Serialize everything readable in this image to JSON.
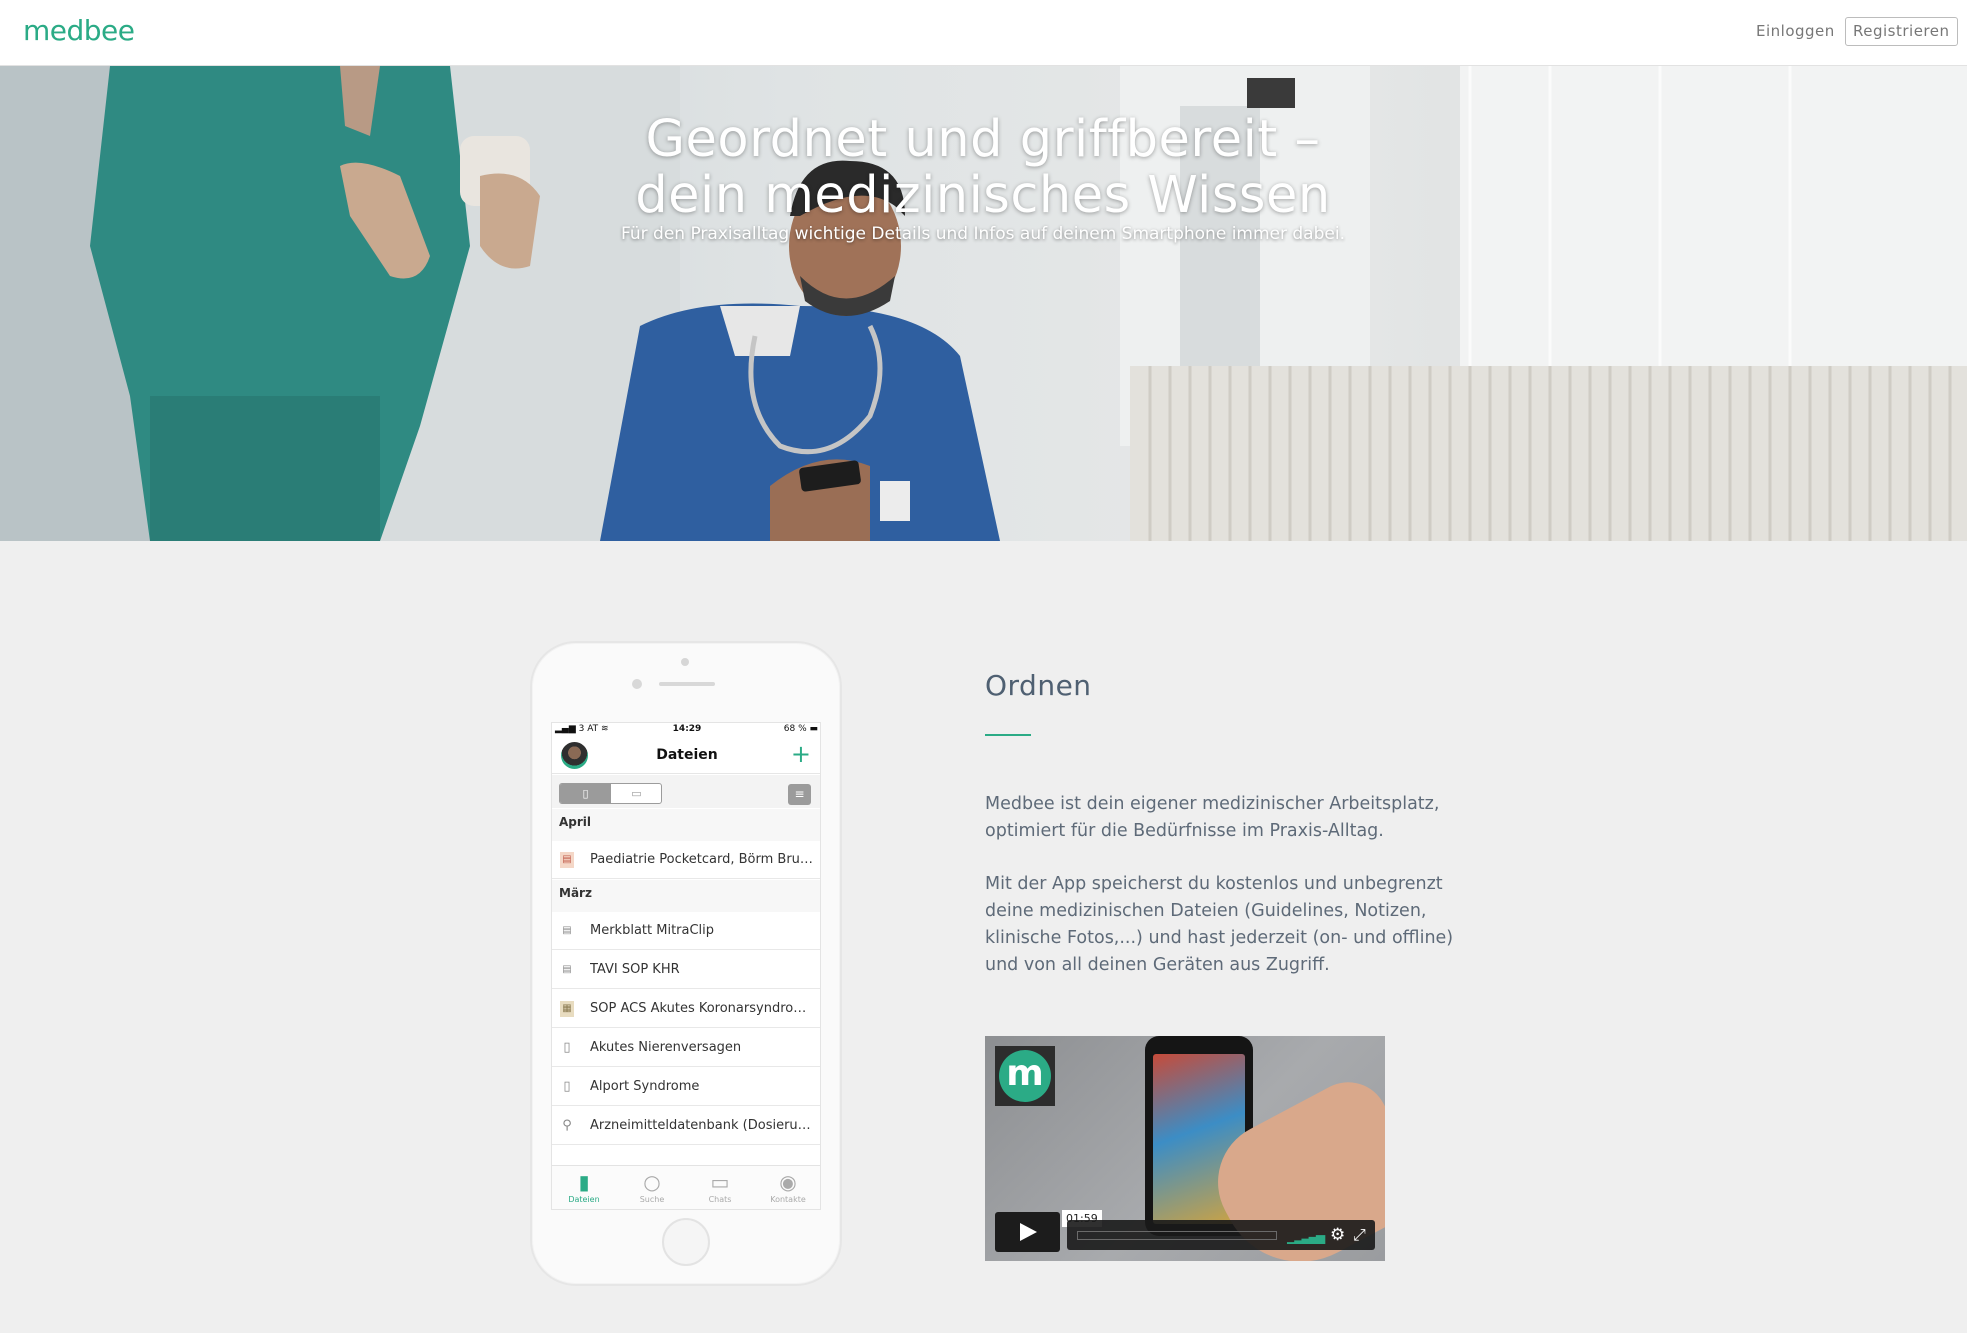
{
  "header": {
    "logo": "medbee",
    "login": "Einloggen",
    "register": "Registrieren"
  },
  "hero": {
    "title": "Geordnet und griffbereit – dein medizinisches Wissen",
    "subtitle": "Für den Praxisalltag wichtige Details und Infos auf deinem Smartphone immer dabei."
  },
  "phone": {
    "status": {
      "carrier": "3 AT",
      "time": "14:29",
      "battery": "68 %"
    },
    "title": "Dateien",
    "sections": [
      {
        "label": "April"
      },
      {
        "label": "März"
      }
    ],
    "files": [
      {
        "name": "Paediatrie Pocketcard, Börm Bru…",
        "icon": "document-thumb-icon"
      },
      {
        "name": "Merkblatt MitraClip",
        "icon": "document-thumb-icon"
      },
      {
        "name": "TAVI SOP KHR",
        "icon": "document-thumb-icon"
      },
      {
        "name": "SOP ACS Akutes Koronarsyndro…",
        "icon": "document-thumb-icon"
      },
      {
        "name": "Akutes Nierenversagen",
        "icon": "document-icon"
      },
      {
        "name": "Alport Syndrome",
        "icon": "document-icon"
      },
      {
        "name": "Arzneimitteldatenbank (Dosieru…",
        "icon": "link-icon"
      }
    ],
    "tabs": [
      {
        "label": "Dateien",
        "icon": "files-icon",
        "active": true
      },
      {
        "label": "Suche",
        "icon": "search-icon",
        "active": false
      },
      {
        "label": "Chats",
        "icon": "chat-icon",
        "active": false
      },
      {
        "label": "Kontakte",
        "icon": "contacts-icon",
        "active": false
      }
    ]
  },
  "content": {
    "title": "Ordnen",
    "paragraph1": "Medbee ist dein eigener medizinischer Arbeitsplatz, optimiert für die Bedürfnisse im Praxis-Alltag.",
    "paragraph2": "Mit der App speicherst du kostenlos und unbegrenzt deine medizinischen Dateien (Guidelines, Notizen, klinische Fotos,...) und hast jederzeit (on- und offline) und von all deinen Geräten aus Zugriff."
  },
  "video": {
    "duration": "01:59"
  },
  "colors": {
    "accent": "#2bab86",
    "heading": "#4f6072",
    "body_text": "#5e6a78",
    "page_background": "#efefef"
  }
}
